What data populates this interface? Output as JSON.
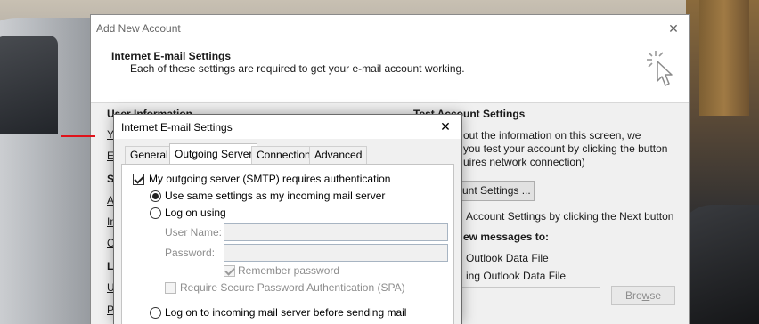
{
  "main_window": {
    "title": "Add New Account",
    "close_glyph": "✕",
    "header_title": "Internet E-mail Settings",
    "header_subtitle": "Each of these settings are required to get your e-mail account working.",
    "header_icon": "cursor-click-icon",
    "left_column": {
      "user_info_heading": "User Information",
      "frag_yo": "Yo",
      "frag_em": "E-",
      "frag_se": "Se",
      "frag_ac": "Ac",
      "frag_in": "Inc",
      "frag_ou": "Ou",
      "frag_lo": "Lo",
      "frag_us": "Us",
      "frag_pa": "Pa"
    },
    "right_column": {
      "test_heading": "Test Account Settings",
      "line1": "out the information on this screen, we",
      "line2": "you test your account by clicking the button",
      "line3": "uires network connection)",
      "test_button": "unt Settings ...",
      "line4": "Account Settings by clicking the Next button",
      "deliver_heading": "ew messages to:",
      "option1": "Outlook Data File",
      "option2": "ing Outlook Data File",
      "browse_button_prefix": "Bro",
      "browse_button_underlined": "w",
      "browse_button_suffix": "se"
    }
  },
  "settings_dialog": {
    "title": "Internet E-mail Settings",
    "close_glyph": "✕",
    "tabs": [
      {
        "label": "General"
      },
      {
        "label": "Outgoing Server"
      },
      {
        "label": "Connection"
      },
      {
        "label": "Advanced"
      }
    ],
    "active_tab": "Outgoing Server",
    "smtp_auth_label": "My outgoing server (SMTP) requires authentication",
    "smtp_auth_checked": true,
    "use_same_settings_label": "Use same settings as my incoming mail server",
    "log_on_using_label": "Log on using",
    "user_name_label": "User Name:",
    "user_name_value": "",
    "password_label": "Password:",
    "password_value": "",
    "remember_password_label": "Remember password",
    "remember_password_checked": true,
    "spa_label": "Require Secure Password Authentication (SPA)",
    "spa_checked": false,
    "log_on_incoming_label": "Log on to incoming mail server before sending mail"
  },
  "colors": {
    "accent_underline": "#e0121a",
    "dialog_bg": "#f0f0f0",
    "disabled_text": "#8d8d8d"
  }
}
